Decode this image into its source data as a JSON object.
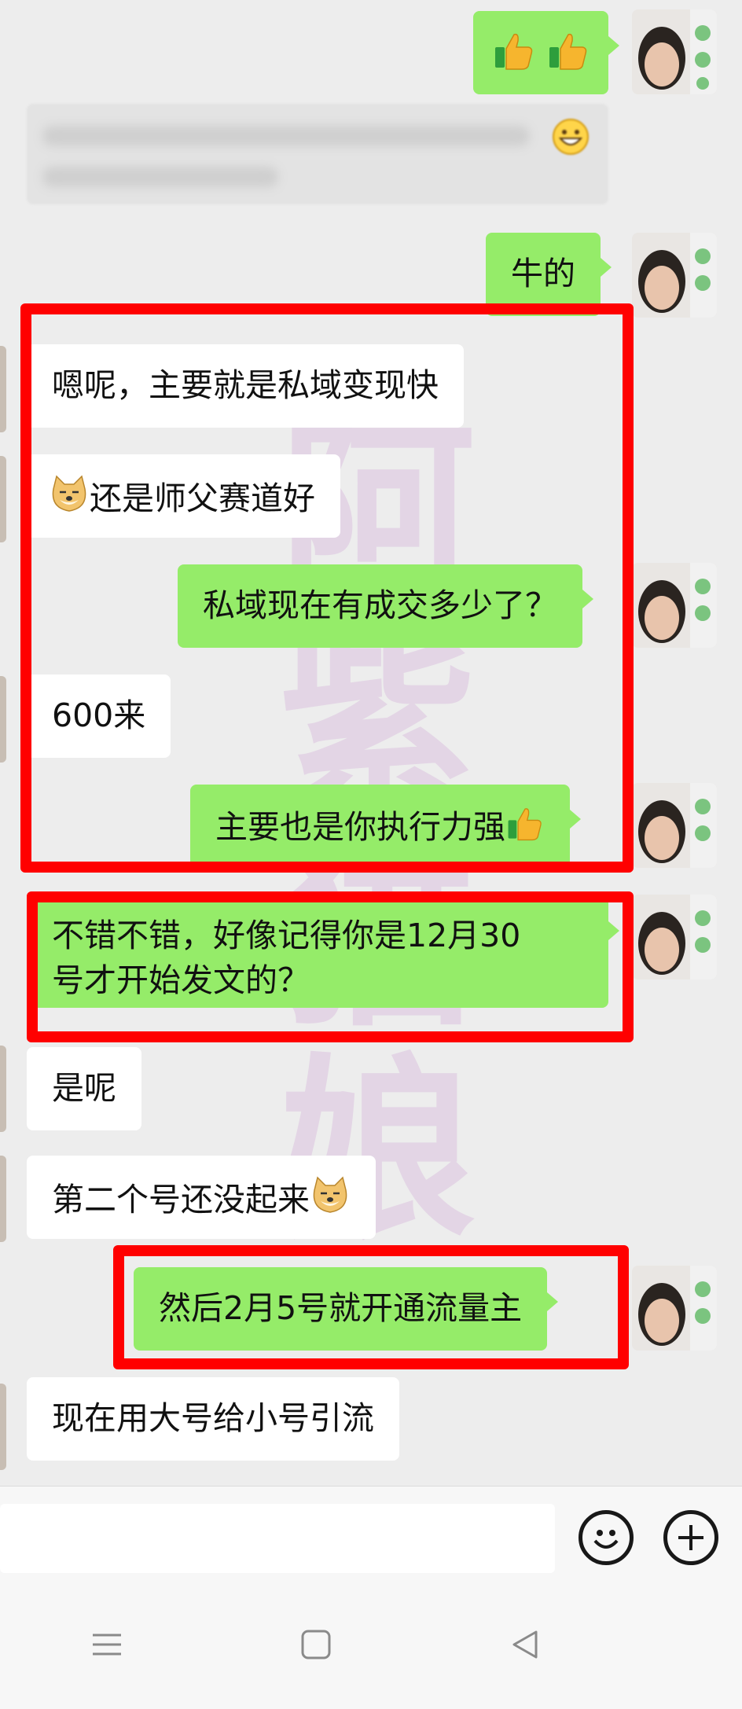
{
  "messages": [
    {
      "text": "牛的"
    },
    {
      "text": "嗯呢，主要就是私域变现快"
    },
    {
      "text": "还是师父赛道好"
    },
    {
      "text": "私域现在有成交多少了？"
    },
    {
      "text": "600来"
    },
    {
      "text": "主要也是你执行力强"
    },
    {
      "line1": "不错不错，好像记得你是12月30",
      "line2": "号才开始发文的？"
    },
    {
      "text": "是呢"
    },
    {
      "text": "第二个号还没起来"
    },
    {
      "text": "然后2月5号就开通流量主"
    },
    {
      "text": "现在用大号给小号引流"
    }
  ],
  "watermark": [
    "阿",
    "紫",
    "猫",
    "娘"
  ],
  "icons": {
    "thumbs_up": "thumbs-up-icon",
    "grin": "grin-emoji-icon",
    "doge": "doge-emoji-icon",
    "emoji_button": "emoji-button-icon",
    "plus": "plus-icon",
    "menu": "menu-icon",
    "home": "home-icon",
    "back": "back-icon"
  },
  "colors": {
    "background": "#ededed",
    "outgoing_bubble": "#95ec69",
    "incoming_bubble": "#ffffff",
    "highlight": "#ff0000"
  }
}
